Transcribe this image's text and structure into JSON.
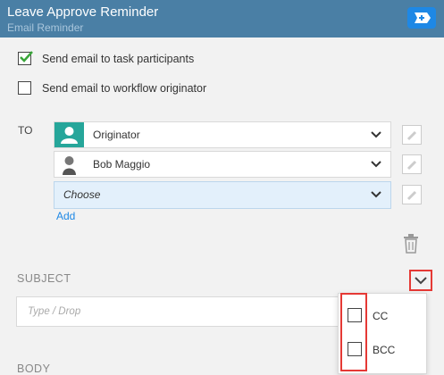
{
  "header": {
    "title": "Leave Approve Reminder",
    "subtitle": "Email Reminder"
  },
  "options": {
    "send_participants": {
      "label": "Send email to task participants",
      "checked": true
    },
    "send_originator": {
      "label": "Send email to workflow originator",
      "checked": false
    }
  },
  "recipients": {
    "label": "TO",
    "rows": [
      {
        "text": "Originator",
        "icon": "user-icon"
      },
      {
        "text": "Bob Maggio",
        "icon": "avatar-icon"
      },
      {
        "text": "Choose",
        "icon": null
      }
    ],
    "add_label": "Add"
  },
  "subject": {
    "label": "SUBJECT",
    "placeholder": "Type / Drop"
  },
  "copy_menu": {
    "items": [
      {
        "label": "CC",
        "checked": false
      },
      {
        "label": "BCC",
        "checked": false
      }
    ]
  },
  "body": {
    "label": "BODY"
  },
  "colors": {
    "header_bg": "#4a7fa5",
    "accent": "#1e88e5",
    "highlight": "#e53935",
    "originator_icon_bg": "#26a69a"
  }
}
